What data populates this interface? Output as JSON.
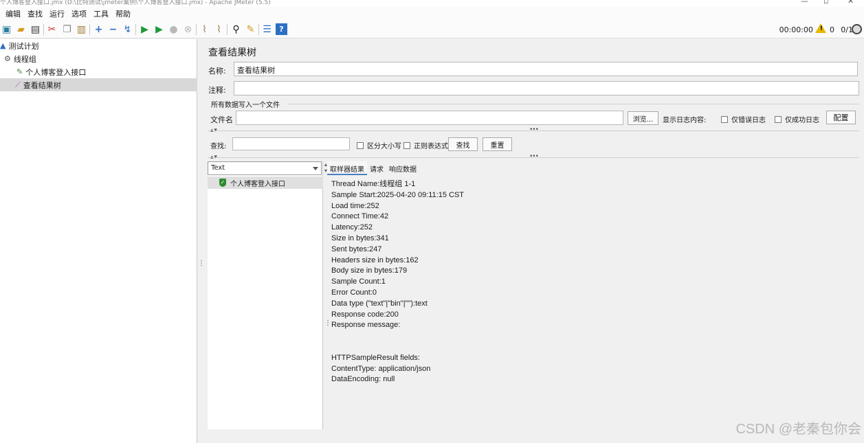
{
  "window": {
    "title": "个人博客登入接口.jmx (D:\\比特测试\\jmeter案例\\个人博客登入接口.jmx) - Apache JMeter (5.5)"
  },
  "menu": [
    "编辑",
    "查找",
    "运行",
    "选项",
    "工具",
    "帮助"
  ],
  "toolbar": {
    "icons": [
      "templates-icon",
      "open-icon",
      "save-icon",
      "cut-icon",
      "copy-icon",
      "paste-icon",
      "expand-icon",
      "collapse-icon",
      "toggle-icon",
      "start-icon",
      "start-no-pause-icon",
      "stop-icon",
      "shutdown-icon",
      "clear-icon",
      "clear-all-icon",
      "search-icon",
      "reset-search-icon",
      "function-helper-icon",
      "help-icon"
    ],
    "timer": "00:00:00",
    "warnings": "0",
    "threads": "0/1"
  },
  "tree": {
    "items": [
      {
        "label": "测试计划",
        "icon": "test-plan-icon",
        "indent": 0
      },
      {
        "label": "线程组",
        "icon": "thread-group-icon",
        "indent": 1
      },
      {
        "label": "个人博客登入接口",
        "icon": "http-sampler-icon",
        "indent": 2
      },
      {
        "label": "查看结果树",
        "icon": "listener-icon",
        "indent": 2,
        "selected": true
      }
    ]
  },
  "panel": {
    "title": "查看结果树",
    "name_label": "名称:",
    "name_value": "查看结果树",
    "comment_label": "注释:",
    "comment_value": "",
    "write_all_label": "所有数据写入一个文件",
    "filename_label": "文件名",
    "filename_value": "",
    "browse_button": "浏览...",
    "log_content_label": "显示日志内容:",
    "errors_only_label": "仅错误日志",
    "success_only_label": "仅成功日志",
    "configure_button": "配置",
    "search_label": "查找:",
    "search_value": "",
    "case_sensitive_label": "区分大小写",
    "regex_label": "正则表达式",
    "find_button": "查找",
    "reset_button": "重置"
  },
  "results": {
    "renderer": "Text",
    "samples": [
      {
        "label": "个人博客登入接口",
        "status": "success"
      }
    ],
    "tabs": [
      "取样器结果",
      "请求",
      "响应数据"
    ],
    "active_tab": 0,
    "details": [
      "Thread Name:线程组 1-1",
      "Sample Start:2025-04-20 09:11:15 CST",
      "Load time:252",
      "Connect Time:42",
      "Latency:252",
      "Size in bytes:341",
      "Sent bytes:247",
      "Headers size in bytes:162",
      "Body size in bytes:179",
      "Sample Count:1",
      "Error Count:0",
      "Data type (\"text\"|\"bin\"|\"\"):text",
      "Response code:200",
      "Response message:",
      "",
      "",
      "HTTPSampleResult fields:",
      "ContentType: application/json",
      "DataEncoding: null"
    ]
  },
  "watermark": "CSDN @老秦包你会"
}
